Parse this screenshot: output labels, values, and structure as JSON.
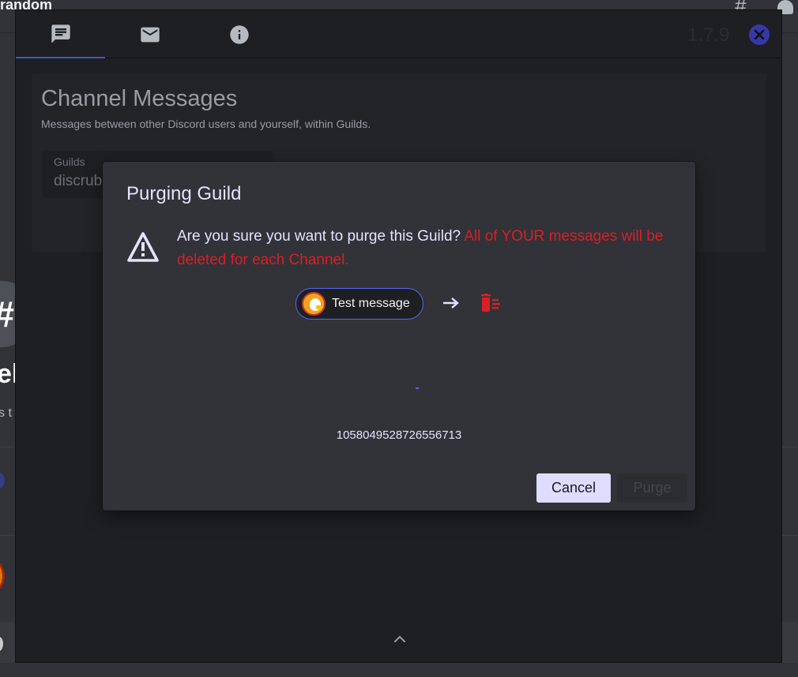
{
  "background": {
    "channel_name": "random",
    "left_initial": "el",
    "left_subtext": "s t",
    "hash_symbol": "#"
  },
  "window": {
    "version": "1.7.9",
    "tabs": [
      {
        "icon": "chat-icon",
        "active": true
      },
      {
        "icon": "mail-icon",
        "active": false
      },
      {
        "icon": "info-icon",
        "active": false
      }
    ],
    "panel": {
      "title": "Channel Messages",
      "description": "Messages between other Discord users and yourself, within Guilds.",
      "guilds_label": "Guilds",
      "guilds_value": "discrub"
    }
  },
  "modal": {
    "title": "Purging Guild",
    "confirm_question": "Are you sure you want to purge this Guild? ",
    "confirm_warning": "All of YOUR messages will be deleted for each Channel.",
    "message_preview": "Test message",
    "guild_id": "1058049528726556713",
    "cancel_label": "Cancel",
    "purge_label": "Purge"
  },
  "colors": {
    "accent": "#5865f2",
    "danger": "#da1f26",
    "cancel_bg": "#dedcff"
  }
}
